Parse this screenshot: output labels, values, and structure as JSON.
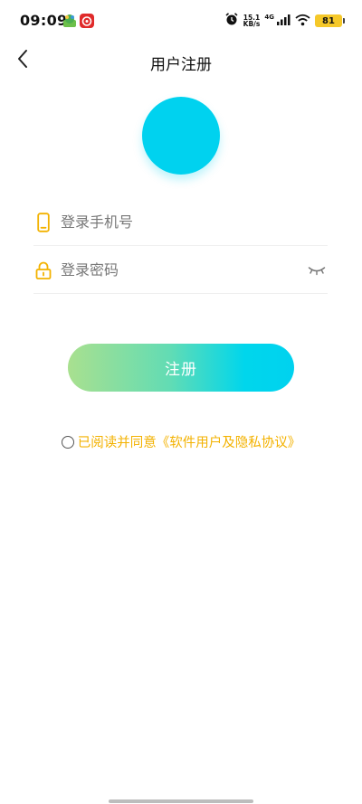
{
  "status_bar": {
    "time": "09:09",
    "net_speed_value": "15.1",
    "net_speed_unit": "KB/s",
    "network": "4G",
    "battery": "81",
    "icons": [
      "green-app-icon",
      "red-app-icon",
      "alarm-icon",
      "signal-icon",
      "wifi-icon",
      "battery-icon"
    ]
  },
  "header": {
    "title": "用户注册",
    "back_icon": "chevron-left-icon"
  },
  "avatar": {
    "color": "#00d2ef"
  },
  "form": {
    "phone_placeholder": "登录手机号",
    "phone_value": "",
    "password_placeholder": "登录密码",
    "password_value": "",
    "phone_icon": "phone-icon",
    "lock_icon": "lock-icon",
    "eye_icon": "eye-closed-icon"
  },
  "register_button": {
    "label": "注册"
  },
  "agreement": {
    "text": "已阅读并同意",
    "link": "《软件用户及隐私协议》",
    "checked": false
  },
  "colors": {
    "accent": "#00d2ef",
    "gradient_start": "#a9e08f",
    "icon_yellow": "#f3b200",
    "agreement_text": "#f3b200"
  }
}
